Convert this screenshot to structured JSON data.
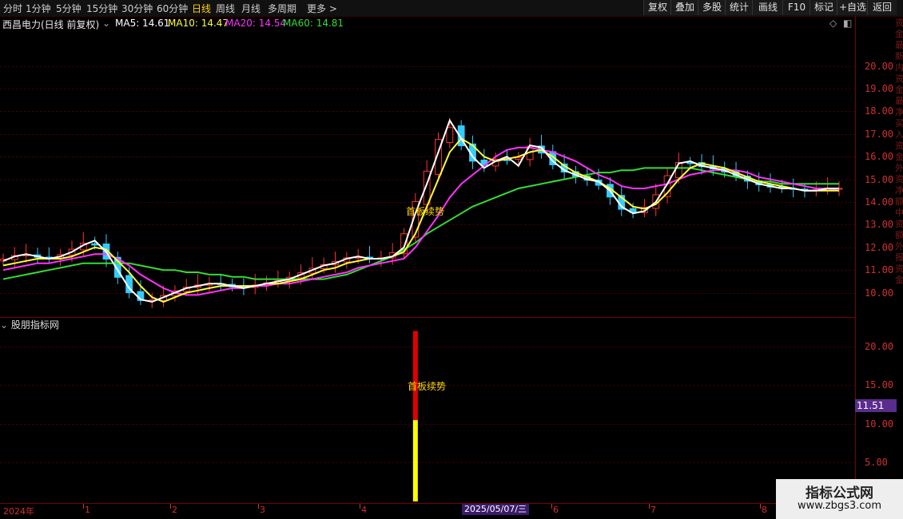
{
  "toolbar": {
    "timeframes": [
      "分时",
      "1分钟",
      "5分钟",
      "15分钟",
      "30分钟",
      "60分钟",
      "日线",
      "周线",
      "月线",
      "多周期",
      "更多 >"
    ],
    "active": "日线",
    "buttons": [
      "复权",
      "叠加",
      "多股",
      "统计",
      "画线",
      "F10",
      "标记",
      "+自选",
      "返回"
    ]
  },
  "info": {
    "stock": "西昌电力(日线 前复权)",
    "ma5": "MA5: 14.61",
    "ma10": "MA10: 14.47",
    "ma20": "MA20: 14.54",
    "ma60": "MA60: 14.81"
  },
  "colors": {
    "up": "#ff3333",
    "down": "#33ccff",
    "ma5": "#ffffff",
    "ma10": "#ffff33",
    "ma20": "#ff33ff",
    "ma60": "#33dd33",
    "signal_top": "#e00000",
    "signal_bottom": "#ffff00"
  },
  "sub": {
    "title": "股朋指标网",
    "signal_label": "首板续势",
    "price_badge": "11.51"
  },
  "main_signal_label": "首板续势",
  "dates": {
    "year": "2024年",
    "months": [
      "1",
      "2",
      "3",
      "4",
      "6",
      "7",
      "8"
    ],
    "cursor": "2025/05/07/三"
  },
  "right_vertical_text": "资金最新内资金最净买入资金外资净额中资额外报资金",
  "watermark": {
    "line1": "指标公式网",
    "line2": "www.zbgs3.com"
  },
  "chart_data": {
    "type": "candlestick",
    "main": {
      "y_ticks": [
        20,
        19,
        18,
        17,
        16,
        15,
        14,
        13,
        12,
        11,
        10
      ],
      "ylim": [
        9.0,
        21.5
      ],
      "ma5": [
        11.4,
        11.6,
        11.7,
        11.6,
        11.5,
        11.6,
        11.8,
        12.1,
        12.3,
        11.8,
        11.0,
        10.2,
        9.7,
        9.6,
        9.8,
        10.0,
        10.2,
        10.3,
        10.4,
        10.4,
        10.3,
        10.2,
        10.3,
        10.4,
        10.5,
        10.6,
        10.8,
        11.0,
        11.2,
        11.3,
        11.5,
        11.6,
        11.5,
        11.5,
        11.6,
        12.0,
        13.5,
        14.8,
        16.2,
        17.6,
        16.8,
        16.0,
        15.5,
        15.8,
        16.0,
        15.6,
        16.5,
        16.4,
        15.8,
        15.4,
        15.2,
        15.0,
        14.9,
        14.5,
        13.8,
        13.5,
        13.6,
        14.0,
        14.8,
        15.7,
        15.8,
        15.6,
        15.5,
        15.4,
        15.2,
        15.0,
        14.8,
        14.7,
        14.6,
        14.6,
        14.5,
        14.5,
        14.6,
        14.6
      ],
      "ma10": [
        11.2,
        11.3,
        11.4,
        11.5,
        11.5,
        11.5,
        11.6,
        11.8,
        12.0,
        11.9,
        11.4,
        10.9,
        10.3,
        9.8,
        9.6,
        9.8,
        10.0,
        10.1,
        10.2,
        10.3,
        10.3,
        10.3,
        10.3,
        10.4,
        10.4,
        10.5,
        10.6,
        10.8,
        11.0,
        11.1,
        11.3,
        11.4,
        11.5,
        11.5,
        11.6,
        11.8,
        12.6,
        13.8,
        15.0,
        16.2,
        16.8,
        16.5,
        16.0,
        15.8,
        15.9,
        16.0,
        16.2,
        16.3,
        16.0,
        15.6,
        15.3,
        15.1,
        14.9,
        14.6,
        14.2,
        13.8,
        13.7,
        13.9,
        14.4,
        15.0,
        15.5,
        15.7,
        15.6,
        15.5,
        15.3,
        15.1,
        14.9,
        14.8,
        14.7,
        14.6,
        14.5,
        14.5,
        14.5,
        14.5
      ],
      "ma20": [
        11.0,
        11.1,
        11.2,
        11.3,
        11.3,
        11.4,
        11.5,
        11.6,
        11.7,
        11.7,
        11.5,
        11.2,
        10.8,
        10.5,
        10.2,
        10.0,
        9.9,
        9.9,
        10.0,
        10.1,
        10.2,
        10.2,
        10.3,
        10.3,
        10.4,
        10.4,
        10.5,
        10.6,
        10.7,
        10.8,
        10.9,
        11.1,
        11.2,
        11.3,
        11.4,
        11.5,
        12.0,
        12.7,
        13.4,
        14.2,
        14.8,
        15.2,
        15.6,
        16.0,
        16.3,
        16.4,
        16.4,
        16.3,
        16.2,
        16.0,
        15.8,
        15.5,
        15.2,
        15.0,
        14.7,
        14.6,
        14.6,
        14.7,
        14.8,
        15.0,
        15.2,
        15.3,
        15.4,
        15.4,
        15.4,
        15.3,
        15.1,
        15.0,
        14.9,
        14.8,
        14.7,
        14.6,
        14.6,
        14.5
      ],
      "ma60": [
        10.6,
        10.7,
        10.8,
        10.9,
        11.0,
        11.1,
        11.2,
        11.3,
        11.3,
        11.3,
        11.3,
        11.3,
        11.2,
        11.1,
        11.0,
        11.0,
        10.9,
        10.9,
        10.8,
        10.8,
        10.7,
        10.7,
        10.6,
        10.6,
        10.6,
        10.6,
        10.6,
        10.6,
        10.6,
        10.7,
        10.8,
        11.0,
        11.2,
        11.4,
        11.6,
        11.9,
        12.2,
        12.6,
        12.9,
        13.2,
        13.5,
        13.8,
        14.0,
        14.2,
        14.4,
        14.6,
        14.7,
        14.8,
        14.9,
        15.0,
        15.1,
        15.2,
        15.3,
        15.3,
        15.4,
        15.4,
        15.5,
        15.5,
        15.5,
        15.5,
        15.5,
        15.4,
        15.3,
        15.2,
        15.1,
        15.0,
        14.9,
        14.9,
        14.8,
        14.8,
        14.8,
        14.8,
        14.8,
        14.8
      ]
    },
    "sub": {
      "y_ticks": [
        20,
        15,
        10,
        5
      ],
      "ylim": [
        0,
        23.5
      ],
      "signal": {
        "index": 36,
        "top": 22.0,
        "split": 10.5,
        "bottom": 0
      }
    }
  }
}
